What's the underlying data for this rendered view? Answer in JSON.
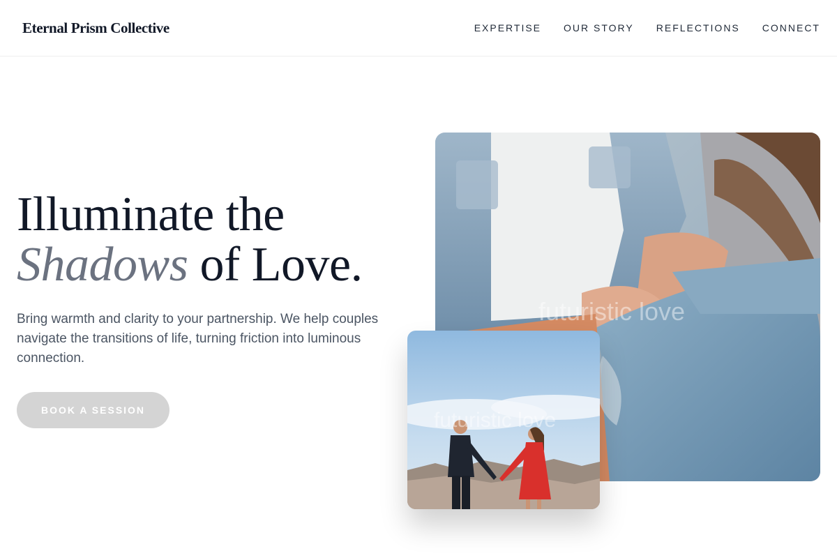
{
  "brand": {
    "name": "Eternal Prism Collective"
  },
  "nav": {
    "items": [
      {
        "label": "EXPERTISE"
      },
      {
        "label": "OUR STORY"
      },
      {
        "label": "REFLECTIONS"
      },
      {
        "label": "CONNECT"
      }
    ]
  },
  "hero": {
    "headline_line1": "Illuminate the",
    "headline_italic": "Shadows",
    "headline_rest": " of Love.",
    "subtitle": "Bring warmth and clarity to your partnership. We help couples navigate the transitions of life, turning friction into luminous connection.",
    "cta_label": "BOOK A SESSION"
  },
  "images": {
    "main_watermark": "futuristic love",
    "small_watermark": "futuristic love"
  },
  "colors": {
    "text_dark": "#111827",
    "text_muted": "#6b7280",
    "body_text": "#4b5563",
    "cta_bg": "#d4d4d4"
  }
}
